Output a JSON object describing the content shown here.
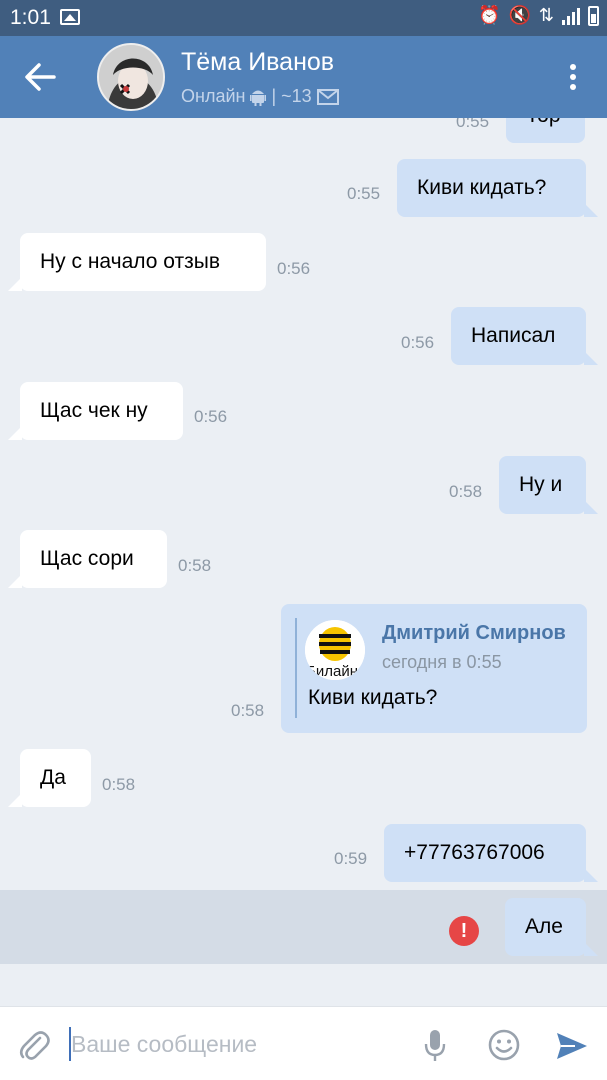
{
  "status_bar": {
    "time": "1:01"
  },
  "header": {
    "name": "Тёма Иванов",
    "status": "Онлайн",
    "separator": "|",
    "unread": "~13"
  },
  "messages": [
    {
      "dir": "out",
      "text": "Тор",
      "time": "0:55"
    },
    {
      "dir": "out",
      "text": "Киви кидать?",
      "time": "0:55"
    },
    {
      "dir": "in",
      "text": "Ну с начало отзыв",
      "time": "0:56"
    },
    {
      "dir": "out",
      "text": "Написал",
      "time": "0:56"
    },
    {
      "dir": "in",
      "text": "Щас чек ну",
      "time": "0:56"
    },
    {
      "dir": "out",
      "text": "Ну и",
      "time": "0:58"
    },
    {
      "dir": "in",
      "text": "Щас сори",
      "time": "0:58"
    },
    {
      "dir": "in",
      "text": "Да",
      "time": "0:58"
    },
    {
      "dir": "out",
      "text": "+77763767006",
      "time": "0:59"
    }
  ],
  "forwarded": {
    "author": "Дмитрий Смирнов",
    "date": "сегодня в 0:55",
    "text": "Киви кидать?",
    "time": "0:58",
    "avatar_text": "Билайн"
  },
  "failed_message": {
    "text": "Але",
    "error_mark": "!"
  },
  "input": {
    "placeholder": "Ваше сообщение",
    "value": ""
  },
  "colors": {
    "header": "#5181b8",
    "status_bar": "#3f5d80",
    "outgoing_bubble": "#cfe0f6",
    "incoming_bubble": "#ffffff",
    "error": "#e64646"
  }
}
